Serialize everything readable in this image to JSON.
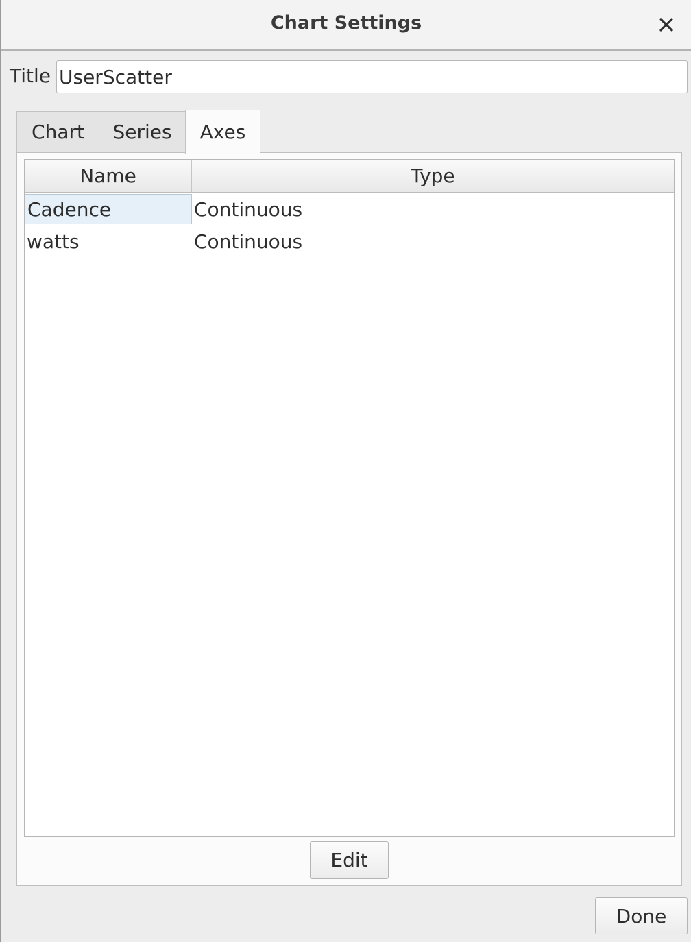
{
  "window": {
    "title": "Chart Settings",
    "close_icon": "close-icon"
  },
  "title_field": {
    "label": "Title",
    "value": "UserScatter"
  },
  "tabs": [
    {
      "label": "Chart",
      "active": false
    },
    {
      "label": "Series",
      "active": false
    },
    {
      "label": "Axes",
      "active": true
    }
  ],
  "axes_table": {
    "columns": [
      "Name",
      "Type"
    ],
    "rows": [
      {
        "name": "Cadence",
        "type": "Continuous",
        "selected": true
      },
      {
        "name": "watts",
        "type": "Continuous",
        "selected": false
      }
    ]
  },
  "buttons": {
    "edit_label": "Edit",
    "done_label": "Done"
  },
  "colors": {
    "selection_bg": "#e6f0f8",
    "window_bg": "#ededed"
  }
}
